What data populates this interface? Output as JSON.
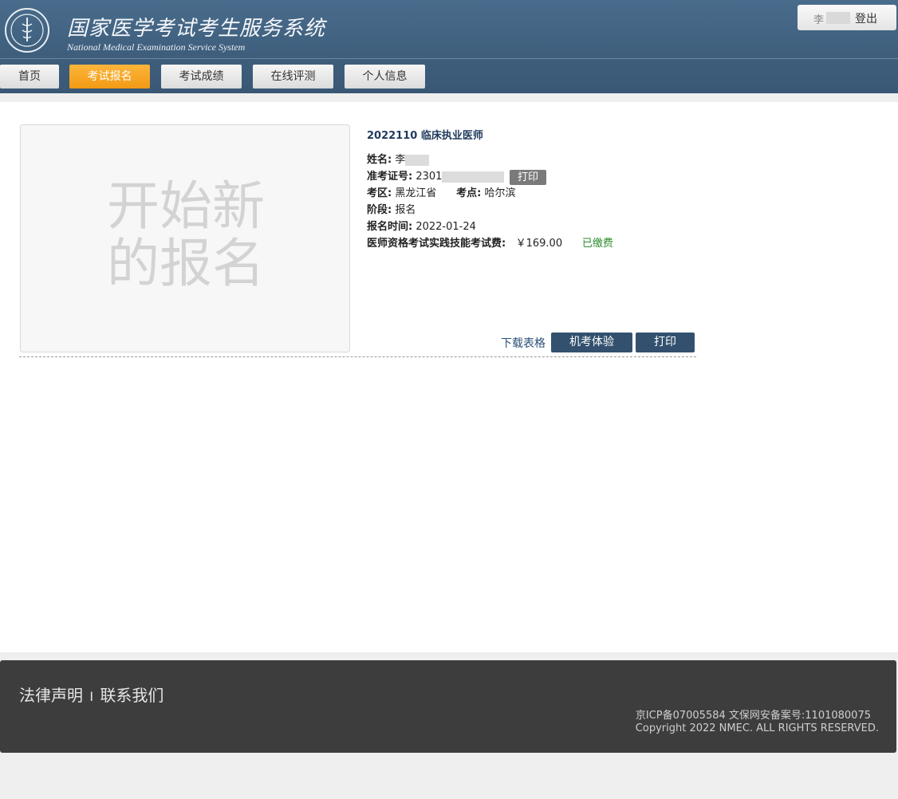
{
  "header": {
    "title_cn": "国家医学考试考生服务系统",
    "title_en": "National Medical Examination Service System",
    "user_name": "李",
    "logout_label": "登出"
  },
  "nav": {
    "items": [
      "首页",
      "考试报名",
      "考试成绩",
      "在线评测",
      "个人信息"
    ],
    "active": "考试报名"
  },
  "photo": {
    "placeholder_text": "开始新的报名"
  },
  "exam": {
    "title": "2022110 临床执业医师",
    "name_label": "姓名:",
    "name_value": "李",
    "ticket_label": "准考证号:",
    "ticket_value": "2301",
    "ticket_print": "打印",
    "region_label": "考区:",
    "region_value": "黑龙江省",
    "site_label": "考点:",
    "site_value": "哈尔滨",
    "stage_label": "阶段:",
    "stage_value": "报名",
    "date_label": "报名时间:",
    "date_value": "2022-01-24",
    "fee_label": "医师资格考试实践技能考试费:",
    "fee_value": "￥169.00",
    "fee_status": "已缴费",
    "status_color": "#2e8b2e"
  },
  "actions": {
    "download": "下载表格",
    "mock_exam": "机考体验",
    "print": "打印"
  },
  "footer": {
    "legal": "法律声明",
    "sep": "I",
    "contact": "联系我们",
    "icp": "京ICP备07005584  文保网安备案号:1101080075",
    "copyright": "Copyright 2022 NMEC. ALL RIGHTS RESERVED."
  },
  "colors": {
    "nav_active": "#f29a14",
    "header_bg": "#3e5e7c",
    "button_dark": "#33516e"
  }
}
